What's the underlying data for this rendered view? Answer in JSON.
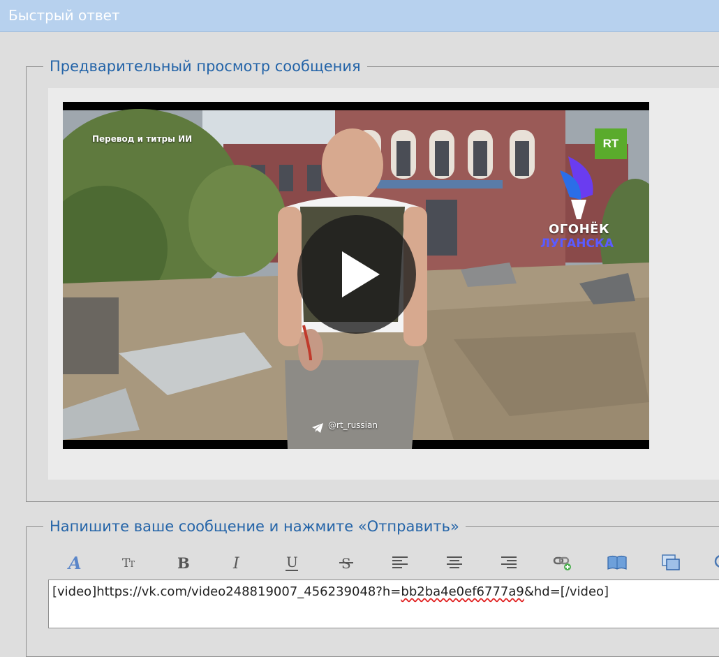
{
  "window": {
    "title": "Быстрый ответ"
  },
  "preview": {
    "legend": "Предварительный просмотр сообщения",
    "video": {
      "caption": "Перевод и титры ИИ",
      "channel_logo": "RT",
      "brand_line1": "ОГОНЁК",
      "brand_line2": "ЛУГАНСКА",
      "watermark": "@rt_russian",
      "play_icon": "play-icon"
    }
  },
  "compose": {
    "legend": "Напишите ваше сообщение и нажмите «Отправить»",
    "toolbar": [
      {
        "name": "font-icon"
      },
      {
        "name": "font-size-icon"
      },
      {
        "name": "bold-icon"
      },
      {
        "name": "italic-icon"
      },
      {
        "name": "underline-icon"
      },
      {
        "name": "strikethrough-icon"
      },
      {
        "name": "align-left-icon"
      },
      {
        "name": "align-center-icon"
      },
      {
        "name": "align-right-icon"
      },
      {
        "name": "insert-link-icon"
      },
      {
        "name": "book-icon"
      },
      {
        "name": "windows-icon"
      },
      {
        "name": "search-icon"
      }
    ],
    "editor": {
      "value_prefix": "[video]https://vk.com/video248819007_456239048?h=",
      "value_misspelled": "bb2ba4e0ef6777a9",
      "value_suffix": "&hd=[/video]"
    }
  },
  "colors": {
    "title_bar": "#b7d1ee",
    "legend_text": "#2464a8",
    "background": "#dedede",
    "rt_green": "#5aab2c"
  }
}
